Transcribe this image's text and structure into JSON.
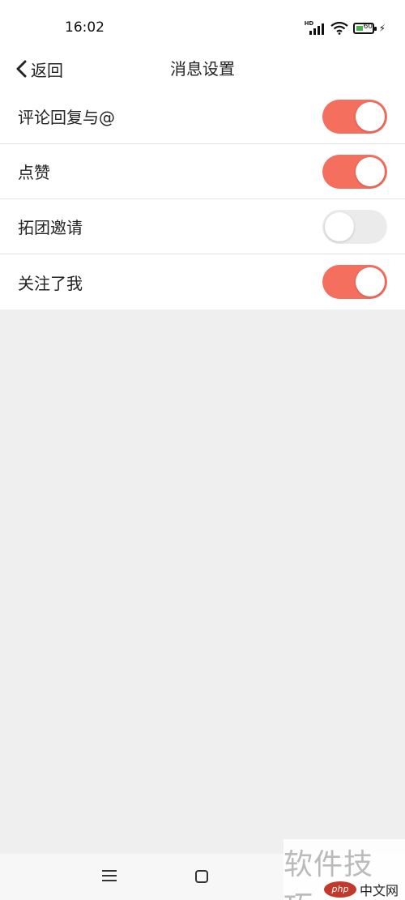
{
  "status_bar": {
    "time": "16:02",
    "signal_label": "HD",
    "battery_level": "60"
  },
  "nav": {
    "back_label": "返回",
    "title": "消息设置"
  },
  "settings": [
    {
      "label": "评论回复与@",
      "enabled": true
    },
    {
      "label": "点赞",
      "enabled": true
    },
    {
      "label": "拓团邀请",
      "enabled": false
    },
    {
      "label": "关注了我",
      "enabled": true
    }
  ],
  "colors": {
    "toggle_on": "#f56f5e",
    "toggle_off": "#ebebeb",
    "background": "#efefef"
  },
  "watermark": {
    "line1": "软件技巧",
    "logo": "php",
    "site": "中文网"
  }
}
